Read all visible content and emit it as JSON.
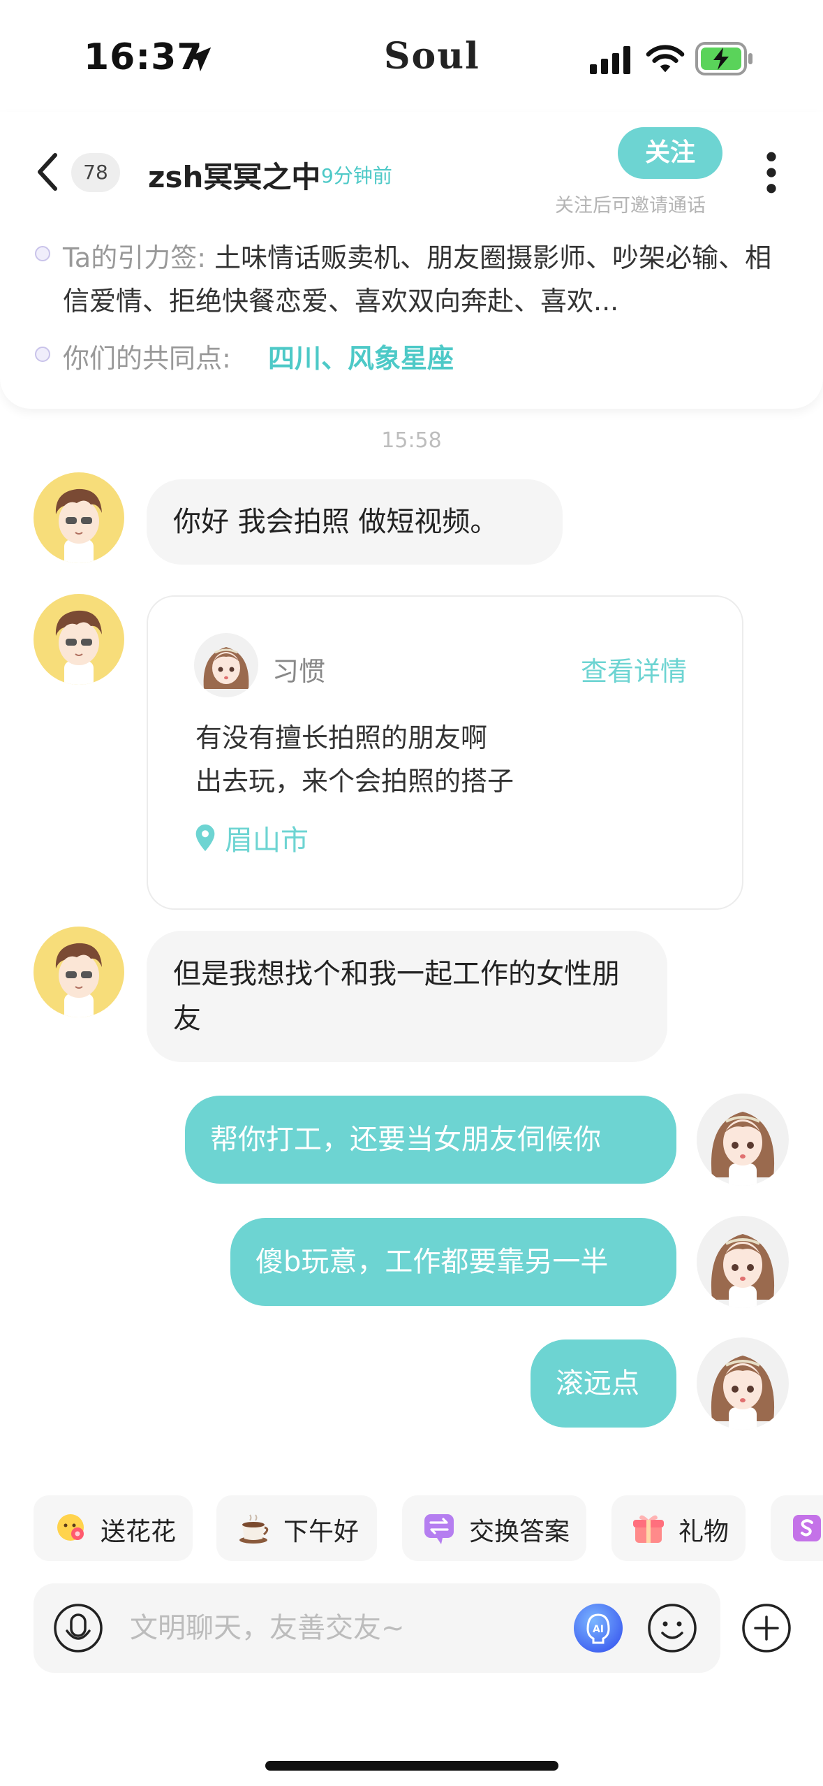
{
  "status_bar": {
    "time": "16:37",
    "app_label": "Soul"
  },
  "header": {
    "badge_count": "78",
    "username": "zsh冥冥之中",
    "last_active": "9分钟前",
    "follow_label": "关注",
    "follow_hint": "关注后可邀请通话",
    "tags_label": "Ta的引力签:",
    "tags_text": "土味情话贩卖机、朋友圈摄影师、吵架必输、相信爱情、拒绝快餐恋爱、喜欢双向奔赴、喜欢...",
    "common_label": "你们的共同点:",
    "common_value": "四川、风象星座"
  },
  "chat": {
    "timestamp": "15:58",
    "messages": [
      {
        "text": "你好 我会拍照 做短视频。"
      },
      {
        "type": "post"
      },
      {
        "text": "但是我想找个和我一起工作的女性朋友"
      },
      {
        "text": "帮你打工，还要当女朋友伺候你"
      },
      {
        "text": "傻b玩意，工作都要靠另一半"
      },
      {
        "text": "滚远点"
      }
    ],
    "post": {
      "author": "习惯",
      "detail_link": "查看详情",
      "line1": "有没有擅长拍照的朋友啊",
      "line2": "出去玩，来个会拍照的搭子",
      "location": "眉山市"
    }
  },
  "quick_actions": [
    {
      "label": "送花花",
      "icon": "flower-emoji-icon"
    },
    {
      "label": "下午好",
      "icon": "coffee-icon"
    },
    {
      "label": "交换答案",
      "icon": "exchange-icon"
    },
    {
      "label": "礼物",
      "icon": "gift-icon"
    },
    {
      "label": "",
      "icon": "soul-coin-icon"
    }
  ],
  "input": {
    "placeholder": "文明聊天，友善交友~"
  },
  "colors": {
    "accent": "#6dd4d2",
    "accent_text": "#4dc9c7",
    "bubble_in": "#f5f5f5"
  }
}
